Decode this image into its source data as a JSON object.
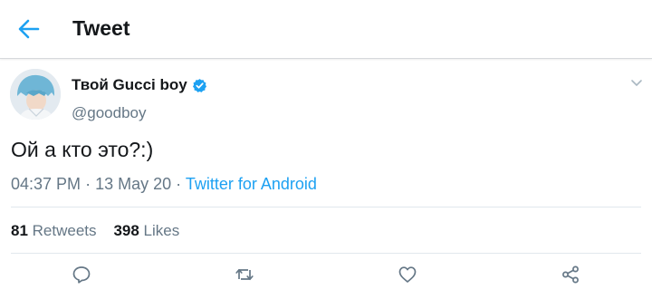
{
  "header": {
    "title": "Tweet",
    "back_icon": "arrow-left-icon"
  },
  "colors": {
    "accent": "#1da1f2",
    "text": "#14171a",
    "muted": "#657786"
  },
  "tweet": {
    "display_name": "Твой Gucci boy",
    "verified": true,
    "handle": "@goodboy",
    "text": "Ой а кто это?:)",
    "time": "04:37 PM",
    "date": "13 May 20",
    "source": "Twitter for Android",
    "separator": "·"
  },
  "stats": {
    "retweets_count": "81",
    "retweets_label": "Retweets",
    "likes_count": "398",
    "likes_label": "Likes"
  },
  "actions": [
    "reply-icon",
    "retweet-icon",
    "like-icon",
    "share-icon"
  ]
}
